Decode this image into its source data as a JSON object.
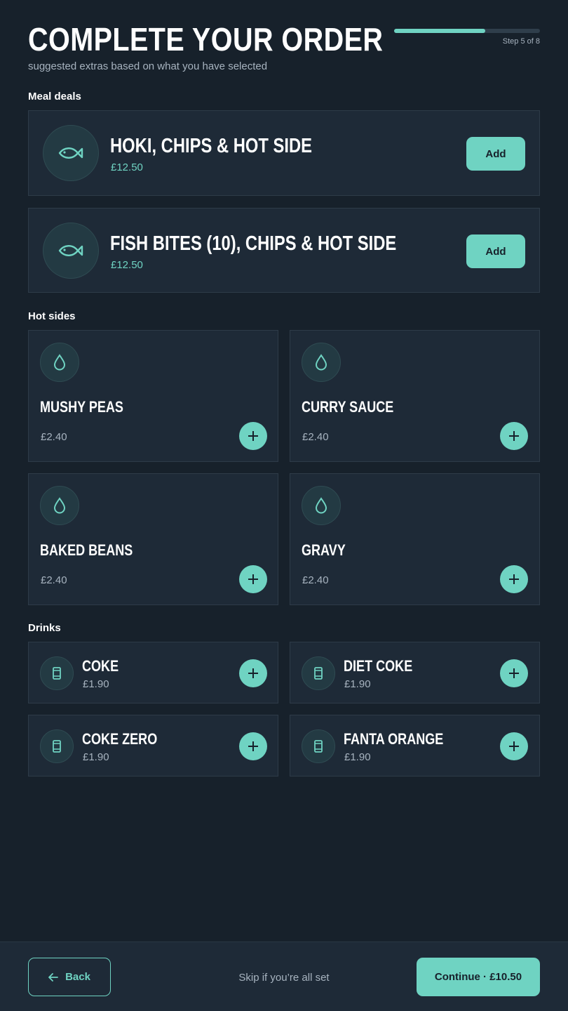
{
  "header": {
    "title": "COMPLETE YOUR ORDER",
    "subtitle": "suggested extras based on what you have selected",
    "step_label": "Step 5 of 8",
    "progress_fraction": 0.625
  },
  "sections": {
    "meal_deals": "Meal deals",
    "hot_sides": "Hot sides",
    "drinks": "Drinks"
  },
  "meal_deals": [
    {
      "name": "HOKI, CHIPS & HOT SIDE",
      "price": "£12.50",
      "button": "Add",
      "icon": "fish-icon"
    },
    {
      "name": "FISH BITES (10), CHIPS & HOT SIDE",
      "price": "£12.50",
      "button": "Add",
      "icon": "fish-icon"
    }
  ],
  "hot_sides": [
    {
      "name": "MUSHY PEAS",
      "price": "£2.40",
      "icon": "drop-icon"
    },
    {
      "name": "CURRY SAUCE",
      "price": "£2.40",
      "icon": "drop-icon"
    },
    {
      "name": "BAKED BEANS",
      "price": "£2.40",
      "icon": "drop-icon"
    },
    {
      "name": "GRAVY",
      "price": "£2.40",
      "icon": "drop-icon"
    }
  ],
  "drinks": [
    {
      "name": "COKE",
      "price": "£1.90",
      "icon": "can-icon"
    },
    {
      "name": "DIET COKE",
      "price": "£1.90",
      "icon": "can-icon"
    },
    {
      "name": "COKE ZERO",
      "price": "£1.90",
      "icon": "can-icon"
    },
    {
      "name": "FANTA ORANGE",
      "price": "£1.90",
      "icon": "can-icon"
    }
  ],
  "footer": {
    "back_label": "Back",
    "skip_text": "Skip if you’re all set",
    "continue_label": "Continue · £10.50"
  },
  "colors": {
    "background": "#17212b",
    "card": "#1e2a37",
    "accent": "#6fd3c2",
    "muted_text": "#a7b3bf"
  }
}
